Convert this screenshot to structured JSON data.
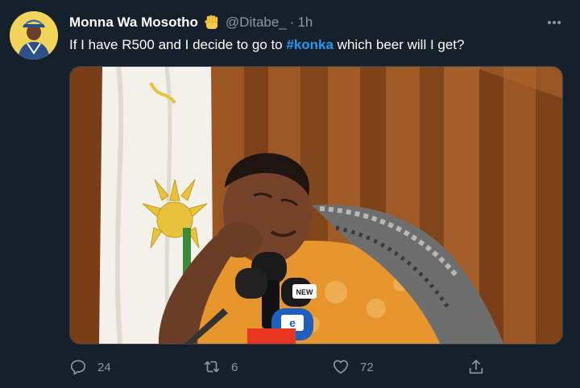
{
  "tweet": {
    "display_name": "Monna Wa Mosotho",
    "badge_emoji_icon": "raised-fist-icon",
    "handle": "@Ditabe_",
    "separator": "·",
    "timestamp": "1h",
    "text_before": "If I have R500 and I decide to go to ",
    "hashtag": "#konka",
    "text_after": " which beer will I get?",
    "media_icons": [
      "enca-mic-logo",
      "news-mic-logo"
    ],
    "actions": {
      "reply_count": "24",
      "retweet_count": "6",
      "like_count": "72",
      "share_icon": "share-icon"
    }
  },
  "colors": {
    "background": "#15202b",
    "text_primary": "#ffffff",
    "text_secondary": "#8b98a5",
    "link": "#1d9bf0"
  }
}
